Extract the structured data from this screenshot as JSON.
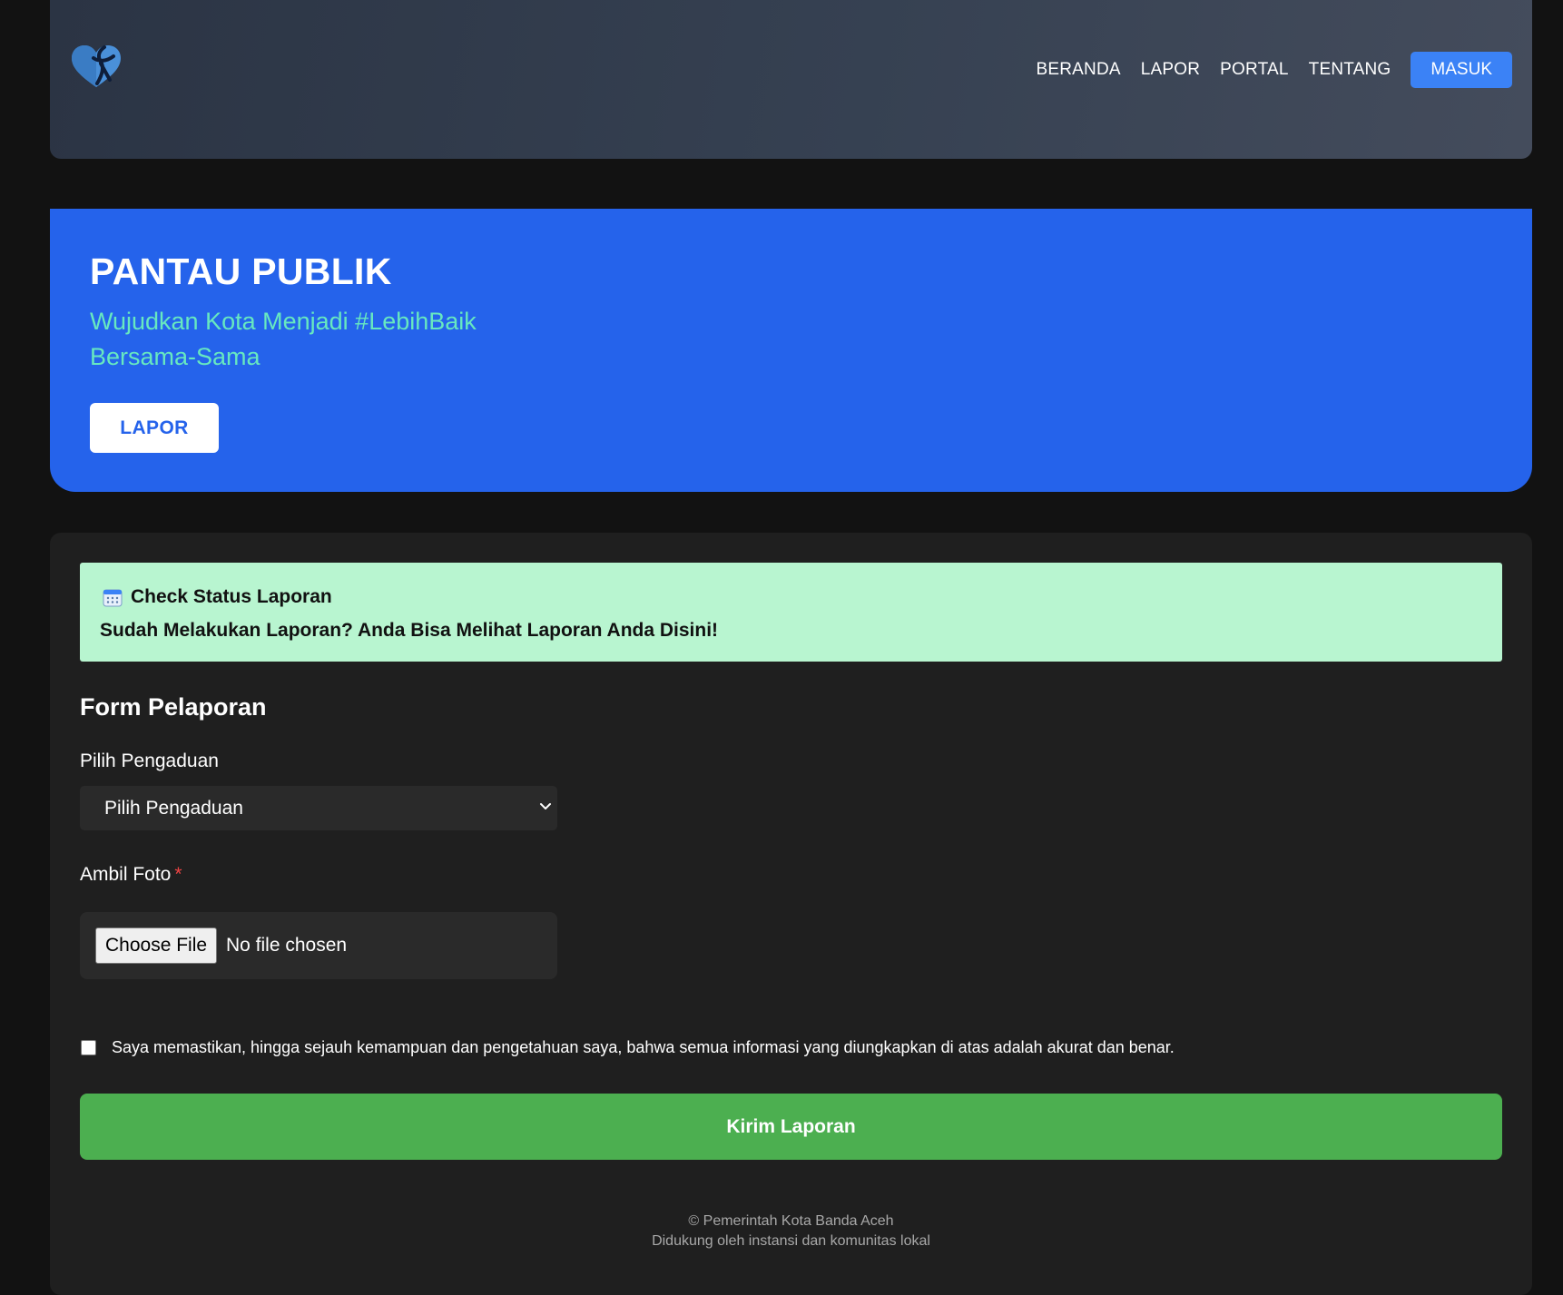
{
  "nav": {
    "logo_icon": "heart-ribbon-icon",
    "links": [
      "BERANDA",
      "LAPOR",
      "PORTAL",
      "TENTANG"
    ],
    "login_label": "MASUK"
  },
  "hero": {
    "title": "PANTAU PUBLIK",
    "subtitle_line1": "Wujudkan Kota Menjadi #LebihBaik",
    "subtitle_line2": "Bersama-Sama",
    "button_label": "LAPOR"
  },
  "alert": {
    "icon": "calendar-icon",
    "title": "Check Status Laporan",
    "text": "Sudah Melakukan Laporan? Anda Bisa Melihat Laporan Anda Disini!"
  },
  "form": {
    "title": "Form Pelaporan",
    "complaint_label": "Pilih Pengaduan",
    "complaint_selected": "Pilih Pengaduan",
    "photo_label": "Ambil Foto",
    "required_mark": "*",
    "file_button_label": "Choose File",
    "file_status": "No file chosen",
    "agreement_text": "Saya memastikan, hingga sejauh kemampuan dan pengetahuan saya, bahwa semua informasi yang diungkapkan di atas adalah akurat dan benar.",
    "agreement_checked": false,
    "submit_label": "Kirim Laporan"
  },
  "footer": {
    "line1": "© Pemerintah Kota Banda Aceh",
    "line2": "Didukung oleh instansi dan komunitas lokal"
  },
  "colors": {
    "primary_blue": "#2563eb",
    "login_blue": "#3b82f6",
    "accent_teal": "#67e8c0",
    "alert_green": "#b8f5d0",
    "submit_green": "#4caf50",
    "background": "#121212",
    "card_background": "#1f1f1f"
  }
}
